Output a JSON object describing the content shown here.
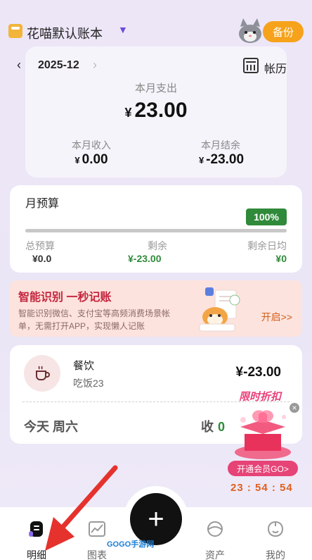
{
  "header": {
    "book_title": "花喵默认账本",
    "backup_label": "备份"
  },
  "month_card": {
    "month": "2025-12",
    "ledger_label": "帐历",
    "expense_label": "本月支出",
    "expense_currency": "¥",
    "expense_value": "23.00",
    "income_label": "本月收入",
    "income_currency": "¥",
    "income_value": "0.00",
    "balance_label": "本月结余",
    "balance_currency": "¥",
    "balance_value": "-23.00"
  },
  "budget": {
    "title": "月预算",
    "percent": "100%",
    "progress_fraction": 1.0,
    "total_label": "总预算",
    "total_value": "¥0.0",
    "remain_label": "剩余",
    "remain_value": "¥-23.00",
    "daily_label": "剩余日均",
    "daily_value": "¥0"
  },
  "promo": {
    "title": "智能识别 一秒记账",
    "desc": "智能识别微信、支付宝等高频消费场景帐单，无需打开APP，实现懒人记账",
    "button": "开启>>"
  },
  "transaction": {
    "category": "餐饮",
    "note": "吃饭23",
    "amount": "¥-23.00",
    "day_label": "今天 周六",
    "income_label": "收",
    "income_value": "0"
  },
  "offer": {
    "title": "限时折扣",
    "button": "开通会员GO>",
    "timer": "23 : 54 : 54"
  },
  "nav": {
    "items": [
      {
        "label": "明细",
        "icon": "detail-icon"
      },
      {
        "label": "图表",
        "icon": "chart-icon"
      },
      {
        "label": "资产",
        "icon": "assets-icon"
      },
      {
        "label": "我的",
        "icon": "profile-icon"
      }
    ],
    "add_icon": "plus-icon"
  },
  "watermark": "GOGO手游网",
  "colors": {
    "accent_orange": "#f6a21b",
    "budget_green": "#2f8a3a",
    "promo_red": "#c4243d",
    "offer_pink": "#e64377"
  }
}
